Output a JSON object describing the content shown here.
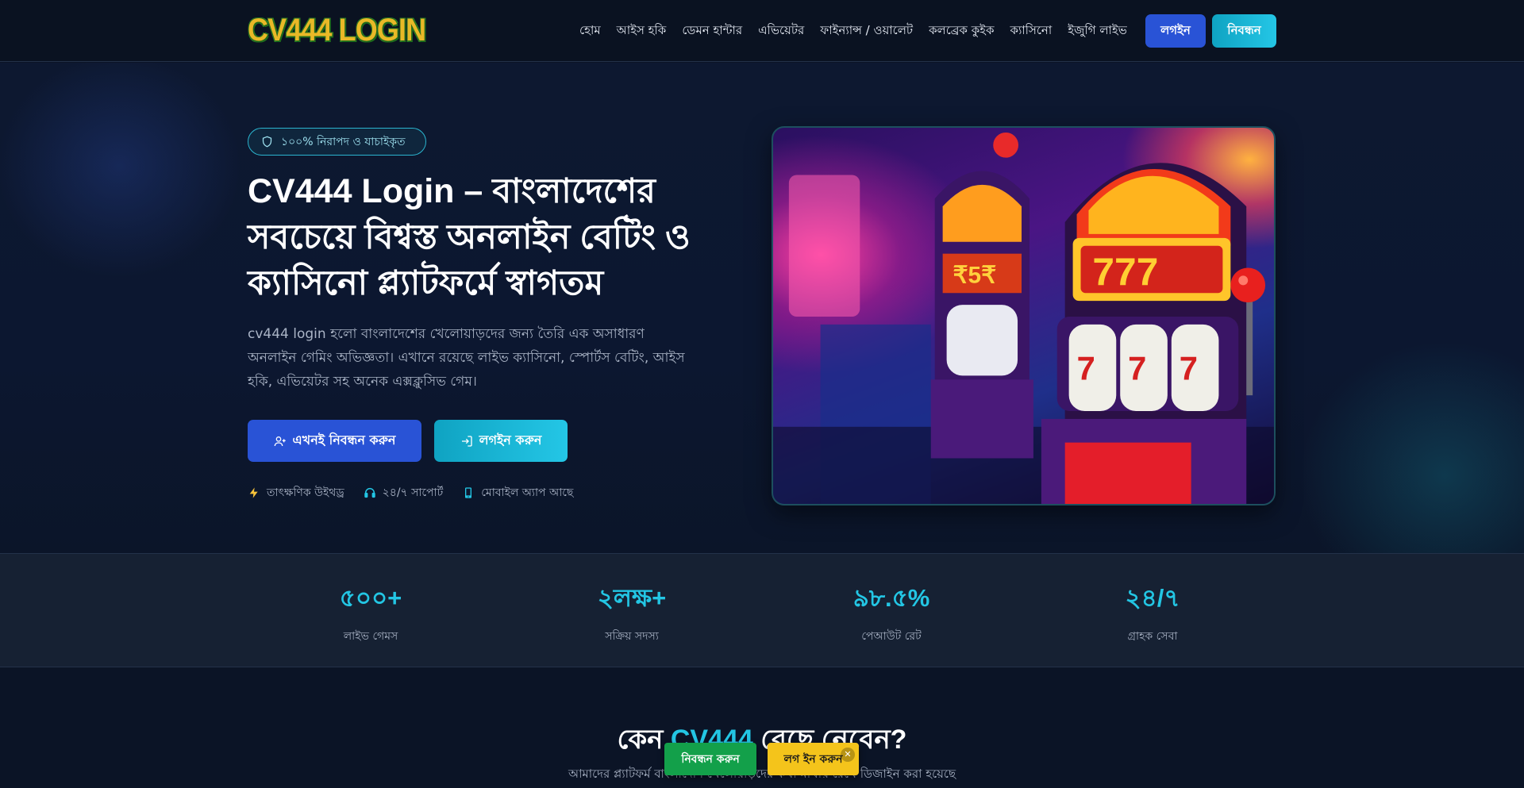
{
  "header": {
    "logo_text": "CV444 LOGIN",
    "nav": [
      "হোম",
      "আইস হকি",
      "ডেমন হান্টার",
      "এভিয়েটর",
      "ফাইন্যান্স / ওয়ালেট",
      "কলব্রেক কুইক",
      "ক্যাসিনো",
      "ইজুগি লাইভ"
    ],
    "login_label": "লগইন",
    "register_label": "নিবন্ধন"
  },
  "hero": {
    "badge": "১০০% নিরাপদ ও যাচাইকৃত",
    "title": "CV444 Login – বাংলাদেশের সবচেয়ে বিশ্বস্ত অনলাইন বেটিং ও ক্যাসিনো প্ল্যাটফর্মে স্বাগতম",
    "description": "cv444 login হলো বাংলাদেশের খেলোয়াড়দের জন্য তৈরি এক অসাধারণ অনলাইন গেমিং অভিজ্ঞতা। এখানে রয়েছে লাইভ ক্যাসিনো, স্পোর্টস বেটিং, আইস হকি, এভিয়েটর সহ অনেক এক্সক্লুসিভ গেম।",
    "cta_register": "এখনই নিবন্ধন করুন",
    "cta_login": "লগইন করুন",
    "features": [
      {
        "icon": "lightning-icon",
        "label": "তাৎক্ষণিক উইথড্র"
      },
      {
        "icon": "headset-icon",
        "label": "২৪/৭ সাপোর্ট"
      },
      {
        "icon": "mobile-icon",
        "label": "মোবাইল অ্যাপ আছে"
      }
    ]
  },
  "stats": [
    {
      "value": "৫০০+",
      "label": "লাইভ গেমস"
    },
    {
      "value": "২লক্ষ+",
      "label": "সক্রিয় সদস্য"
    },
    {
      "value": "৯৮.৫%",
      "label": "পেআউট রেট"
    },
    {
      "value": "২৪/৭",
      "label": "গ্রাহক সেবা"
    }
  ],
  "why": {
    "title_prefix": "কেন ",
    "title_accent": "CV444",
    "title_suffix": " বেছে নেবেন?",
    "subtitle": "আমাদের প্ল্যাটফর্ম বাংলাদেশি খেলোয়াড়দের কথা মাথায় রেখে ডিজাইন করা হয়েছে"
  },
  "floating": {
    "register_label": "নিবন্ধন করুন",
    "login_label": "লগ ইন করুন",
    "close": "✕"
  },
  "colors": {
    "accent_blue": "#2953d6",
    "accent_cyan": "#23c6e4",
    "background": "#0b1426",
    "float_green": "#13a04a",
    "float_yellow": "#f4c41b"
  }
}
